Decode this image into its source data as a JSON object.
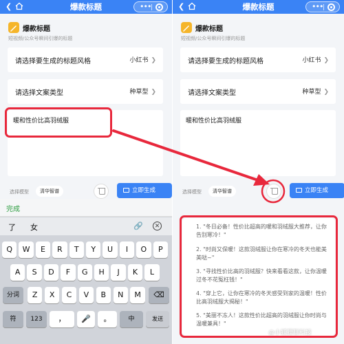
{
  "app": {
    "title": "爆款标题",
    "subtitle": "短视频/公众号瞬间引爆的标题",
    "header_title": "爆款标题"
  },
  "form": {
    "style_label": "请选择要生成的标题风格",
    "style_value": "小红书",
    "type_label": "请选择文案类型",
    "type_value": "种草型",
    "input_text": "暖和性价比高羽绒服",
    "model_label": "选择模型",
    "model_value": "清华智谱",
    "generate_label": "立即生成"
  },
  "keyboard": {
    "done_label": "完成",
    "candidates": [
      "了",
      "女"
    ],
    "row1": [
      "Q",
      "W",
      "E",
      "R",
      "T",
      "Y",
      "U",
      "I",
      "O",
      "P"
    ],
    "row2": [
      "A",
      "S",
      "D",
      "F",
      "G",
      "H",
      "J",
      "K",
      "L"
    ],
    "row3_left": "分词",
    "row3": [
      "Z",
      "X",
      "C",
      "V",
      "B",
      "N",
      "M"
    ],
    "sym": "符",
    "num": "123",
    "lang": "中",
    "enter": "发送"
  },
  "results": [
    "1. \"冬日必备！性价比超高的暖和羽绒服大推荐，让你告别寒冷！\"",
    "2. \"时尚又保暖！这款羽绒服让你在寒冷的冬天也能美美哒~\"",
    "3. \"寻找性价比高的羽绒服？快来看看这款，让你温暖过冬不花冤枉钱！\"",
    "4. \"穿上它，让你在寒冷的冬天感受到家的温暖！性价比高羽绒服大揭秘！\"",
    "5. \"美丽不冻人！这款性价比超高的羽绒服让你时尚与温暖兼具！\""
  ],
  "watermark": "@小狐狸聊科技",
  "colors": {
    "brand_blue": "#3a83f5",
    "highlight_red": "#e8283c",
    "done_green": "#2f9e42"
  }
}
